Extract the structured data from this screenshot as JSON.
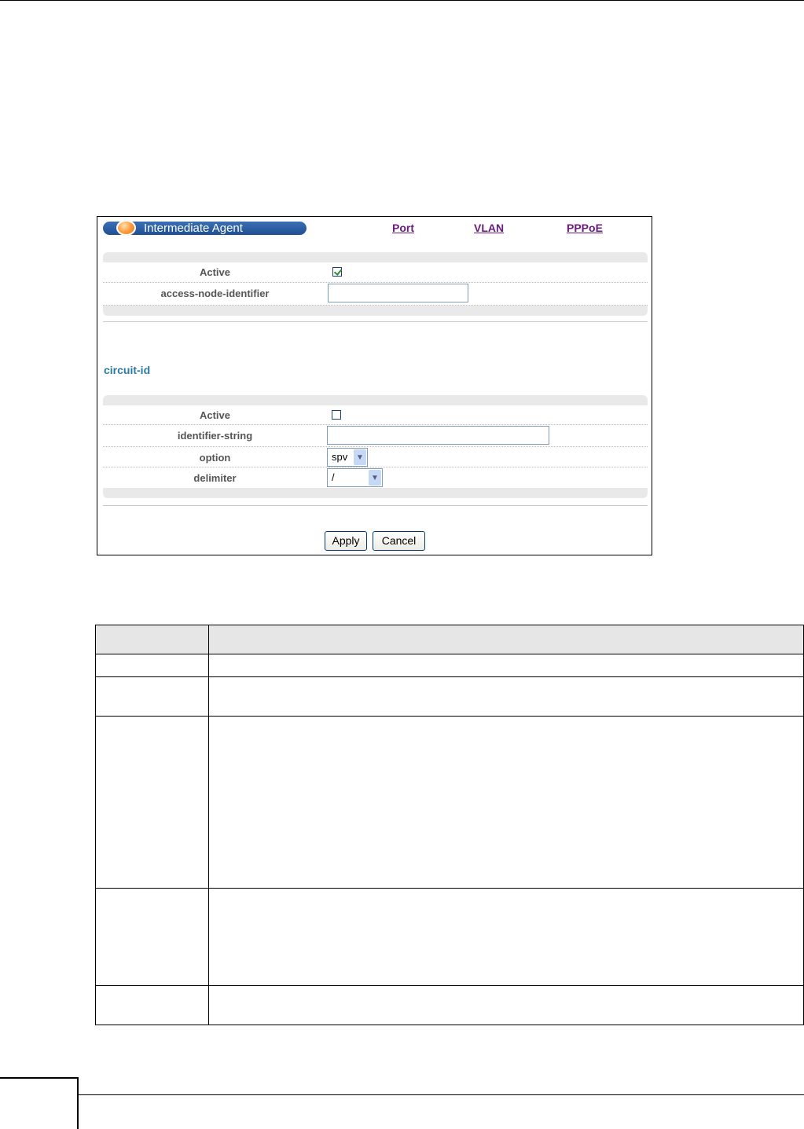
{
  "header": {
    "title": "Intermediate Agent",
    "links": [
      "Port",
      "VLAN",
      "PPPoE"
    ]
  },
  "agent": {
    "active_label": "Active",
    "active_checked": true,
    "identifier_label": "access-node-identifier",
    "identifier_value": ""
  },
  "circuit": {
    "title": "circuit-id",
    "active_label": "Active",
    "active_checked": false,
    "identifier_label": "identifier-string",
    "identifier_value": "",
    "option_label": "option",
    "option_value": "spv",
    "delimiter_label": "delimiter",
    "delimiter_value": "/"
  },
  "buttons": {
    "apply": "Apply",
    "cancel": "Cancel"
  },
  "colors": {
    "title_bar": "#1f4f93",
    "link": "#6a1b7d",
    "section_title": "#2b7aa0"
  }
}
